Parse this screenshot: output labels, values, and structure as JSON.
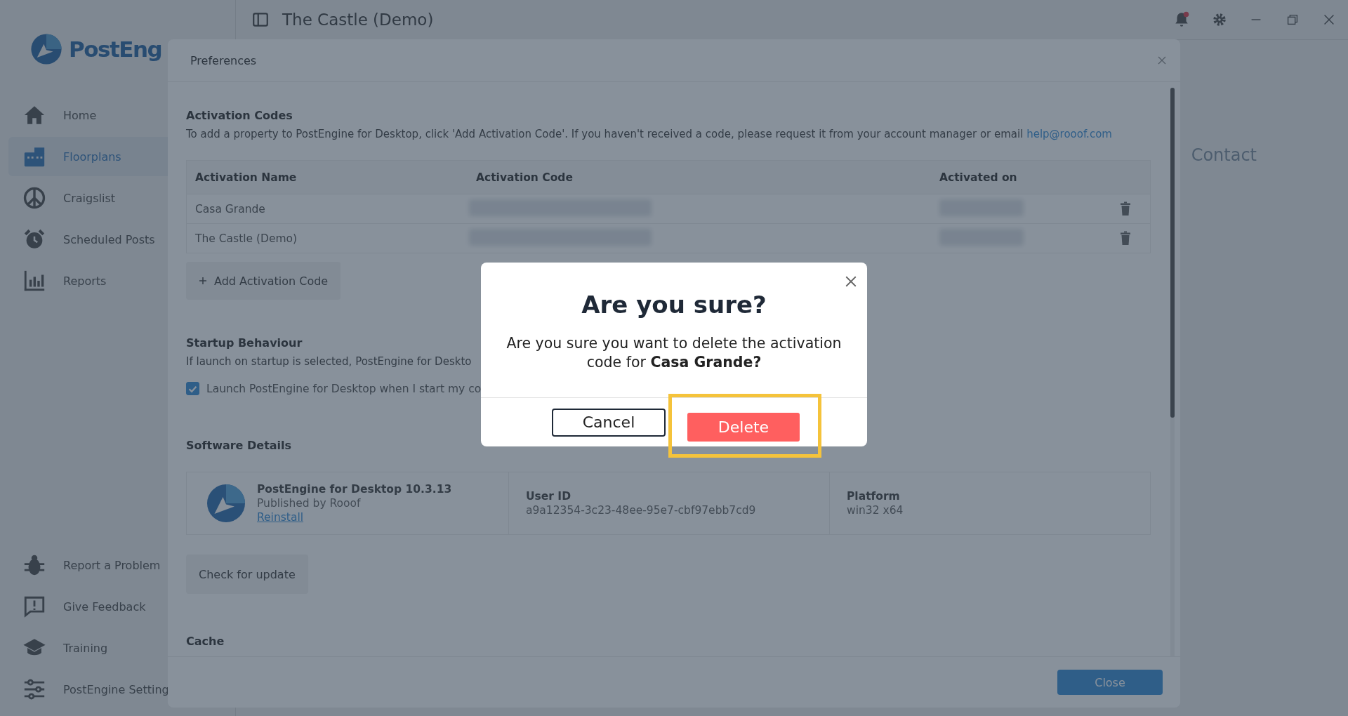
{
  "app": {
    "logo": "PostEng",
    "title": "The Castle (Demo)",
    "background_heading": "Contact"
  },
  "sidebar": {
    "items": [
      {
        "label": "Home",
        "selected": false
      },
      {
        "label": "Floorplans",
        "selected": true
      },
      {
        "label": "Craigslist",
        "selected": false
      },
      {
        "label": "Scheduled Posts",
        "selected": false
      },
      {
        "label": "Reports",
        "selected": false
      }
    ],
    "bottom_items": [
      {
        "label": "Report a Problem"
      },
      {
        "label": "Give Feedback"
      },
      {
        "label": "Training"
      },
      {
        "label": "PostEngine Setting"
      }
    ]
  },
  "preferences": {
    "title": "Preferences",
    "activation": {
      "heading": "Activation Codes",
      "text": "To add a property to PostEngine for Desktop, click 'Add Activation Code'. If you haven't received a code, please request it from your account manager or email ",
      "email": "help@rooof.com",
      "columns": [
        "Activation Name",
        "Activation Code",
        "Activated on"
      ],
      "rows": [
        {
          "name": "Casa Grande"
        },
        {
          "name": "The Castle (Demo)"
        }
      ],
      "add_button": "Add Activation Code"
    },
    "startup": {
      "heading": "Startup Behaviour",
      "text": "If launch on startup is selected, PostEngine for Deskto",
      "checkbox_label": "Launch PostEngine for Desktop when I start my co",
      "checked": true
    },
    "software": {
      "heading": "Software Details",
      "product": "PostEngine for Desktop 10.3.13",
      "publisher": "Published by Rooof",
      "reinstall": "Reinstall",
      "user_id_label": "User ID",
      "user_id": "a9a12354-3c23-48ee-95e7-cbf97ebb7cd9",
      "platform_label": "Platform",
      "platform": "win32 x64"
    },
    "update_button": "Check for update",
    "cache_heading": "Cache",
    "close_button": "Close"
  },
  "confirm": {
    "title": "Are you sure?",
    "message": "Are you sure you want to delete the activation code for **Casa Grande?**",
    "cancel": "Cancel",
    "delete": "Delete",
    "delete_highlighted": true
  }
}
